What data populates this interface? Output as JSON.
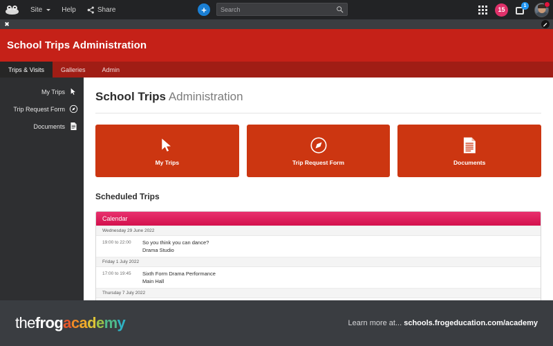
{
  "toolbar": {
    "logo_name": "frog-logo",
    "site_label": "Site",
    "help_label": "Help",
    "share_label": "Share",
    "plus_label": "+",
    "search_placeholder": "Search",
    "search_value": "",
    "apps_badge_count": "15",
    "notification_count": "1"
  },
  "window": {
    "close_label": "✖"
  },
  "banner": {
    "title": "School Trips Administration",
    "accent_color": "#c52118",
    "nav_color": "#a01d15",
    "tabs": [
      {
        "label": "Trips & Visits",
        "active": true
      },
      {
        "label": "Galleries",
        "active": false
      },
      {
        "label": "Admin",
        "active": false
      }
    ]
  },
  "sidebar": {
    "items": [
      {
        "label": "My Trips",
        "icon": "cursor-icon"
      },
      {
        "label": "Trip Request Form",
        "icon": "compass-icon"
      },
      {
        "label": "Documents",
        "icon": "document-icon"
      }
    ]
  },
  "main": {
    "title_bold": "School Trips",
    "title_light": "Administration",
    "cards": [
      {
        "label": "My Trips",
        "icon": "cursor-icon"
      },
      {
        "label": "Trip Request Form",
        "icon": "compass-icon"
      },
      {
        "label": "Documents",
        "icon": "document-icon"
      }
    ],
    "card_color": "#cc3611",
    "section_title": "Scheduled Trips",
    "calendar": {
      "header": "Calendar",
      "header_color": "#e0316a",
      "days": [
        {
          "date": "Wednesday 29 June 2022",
          "events": [
            {
              "time": "19:00 to 22:00",
              "title": "So you think you can dance?",
              "location": "Drama Studio"
            }
          ]
        },
        {
          "date": "Friday 1 July 2022",
          "events": [
            {
              "time": "17:00 to 19:45",
              "title": "Sixth Form Drama Performance",
              "location": "Main Hall"
            }
          ]
        },
        {
          "date": "Thursday 7 July 2022",
          "events": []
        }
      ]
    }
  },
  "footer": {
    "logo_the": "the",
    "logo_frog": "frog",
    "logo_academy": "academy",
    "academy_colors": [
      "#e8582a",
      "#ef8a26",
      "#f0a92a",
      "#ddc337",
      "#9cc348",
      "#4fb98a",
      "#2fb3c4"
    ],
    "learn_more": "Learn more at...",
    "url": "schools.frogeducation.com/academy"
  }
}
